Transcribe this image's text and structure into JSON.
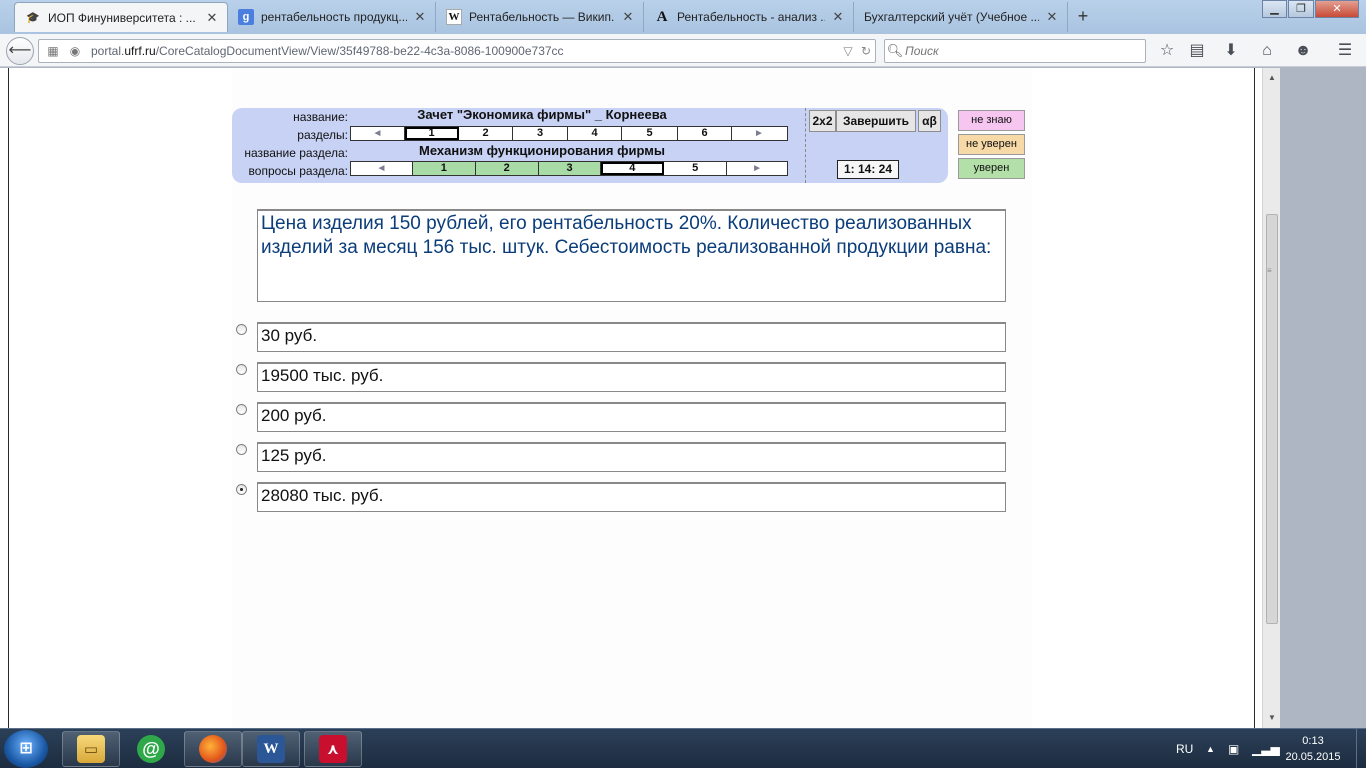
{
  "browser": {
    "tabs": [
      {
        "title": "ИОП Финуниверситета : ...",
        "favicon": "graduation-cap-icon",
        "active": true
      },
      {
        "title": "рентабельность продукц...",
        "favicon": "google-icon",
        "active": false
      },
      {
        "title": "Рентабельность — Викип...",
        "favicon": "wikipedia-icon",
        "active": false
      },
      {
        "title": "Рентабельность - анализ ...",
        "favicon": "academic-a-icon",
        "active": false
      },
      {
        "title": "Бухгалтерский учёт (Учебное ...",
        "favicon": "",
        "active": false
      }
    ],
    "new_tab": "+",
    "url_prefix": "portal.",
    "url_domain": "ufrf.ru",
    "url_path": "/CoreCatalogDocumentView/View/35f49788-be22-4c3a-8086-100900e737cc",
    "search_placeholder": "Поиск"
  },
  "panel": {
    "label_name": "название:",
    "label_sections": "разделы:",
    "label_section_name": "название раздела:",
    "label_questions": "вопросы раздела:",
    "test_title": "Зачет \"Экономика фирмы\" _ Корнеева",
    "section_title": "Механизм функционирования  фирмы",
    "sections": [
      "1",
      "2",
      "3",
      "4",
      "5",
      "6"
    ],
    "current_section": "1",
    "questions": [
      "1",
      "2",
      "3",
      "4",
      "5"
    ],
    "answered_questions": [
      "1",
      "2",
      "3"
    ],
    "current_question": "4",
    "nav_prev": "◄",
    "nav_next": "►",
    "btn_2x2": "2x2",
    "btn_finish": "Завершить",
    "btn_alphabeta": "αβ",
    "timer": "1: 14: 24"
  },
  "confidence": {
    "dont_know": "не знаю",
    "not_sure": "не уверен",
    "sure": "уверен",
    "colors": {
      "dont_know": "#f6c6f0",
      "not_sure": "#f6d9a6",
      "sure": "#b3e0a9"
    }
  },
  "question": {
    "text": "Цена изделия 150 рублей, его рентабельность 20%. Количество реализованных изделий за месяц 156 тыс. штук.  Себестоимость реализованной продукции  равна:",
    "color": "#0b3d7a"
  },
  "answers": [
    {
      "text": "30 руб.",
      "selected": false
    },
    {
      "text": "19500 тыс. руб.",
      "selected": false
    },
    {
      "text": "200 руб.",
      "selected": false
    },
    {
      "text": "125 руб.",
      "selected": false
    },
    {
      "text": "28080 тыс.  руб.",
      "selected": true
    }
  ],
  "taskbar": {
    "apps": [
      "file-explorer-icon",
      "mail-agent-icon",
      "firefox-icon",
      "word-icon",
      "acrobat-icon"
    ],
    "language": "RU",
    "time": "0:13",
    "date": "20.05.2015"
  }
}
